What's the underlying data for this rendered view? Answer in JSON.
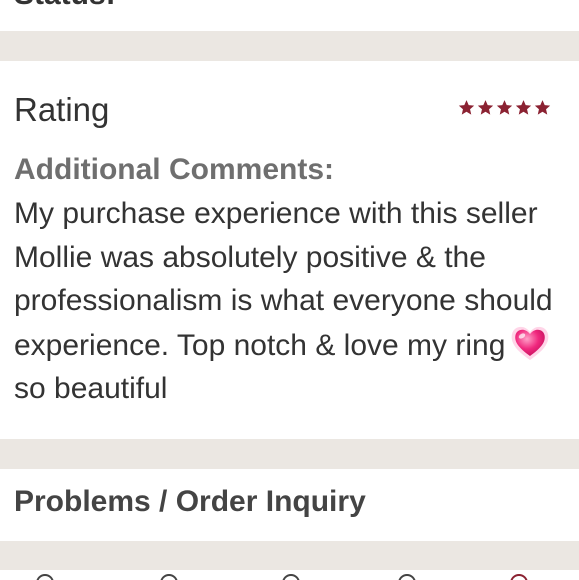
{
  "status": {
    "label": "Status:"
  },
  "rating": {
    "title": "Rating",
    "stars": 5,
    "max_stars": 5,
    "star_color": "#8b2232"
  },
  "comments": {
    "label": "Additional Comments:",
    "text_before": "My purchase experience with this seller Mollie was absolutely positive & the professionalism is what everyone should experience. Top notch & love my ring",
    "emoji": "heart-emoji",
    "text_after": "so beautiful"
  },
  "problems": {
    "label": "Problems / Order Inquiry"
  },
  "colors": {
    "background": "#ebe7e2",
    "card": "#ffffff",
    "text": "#333333",
    "muted": "#6f6f6f"
  }
}
